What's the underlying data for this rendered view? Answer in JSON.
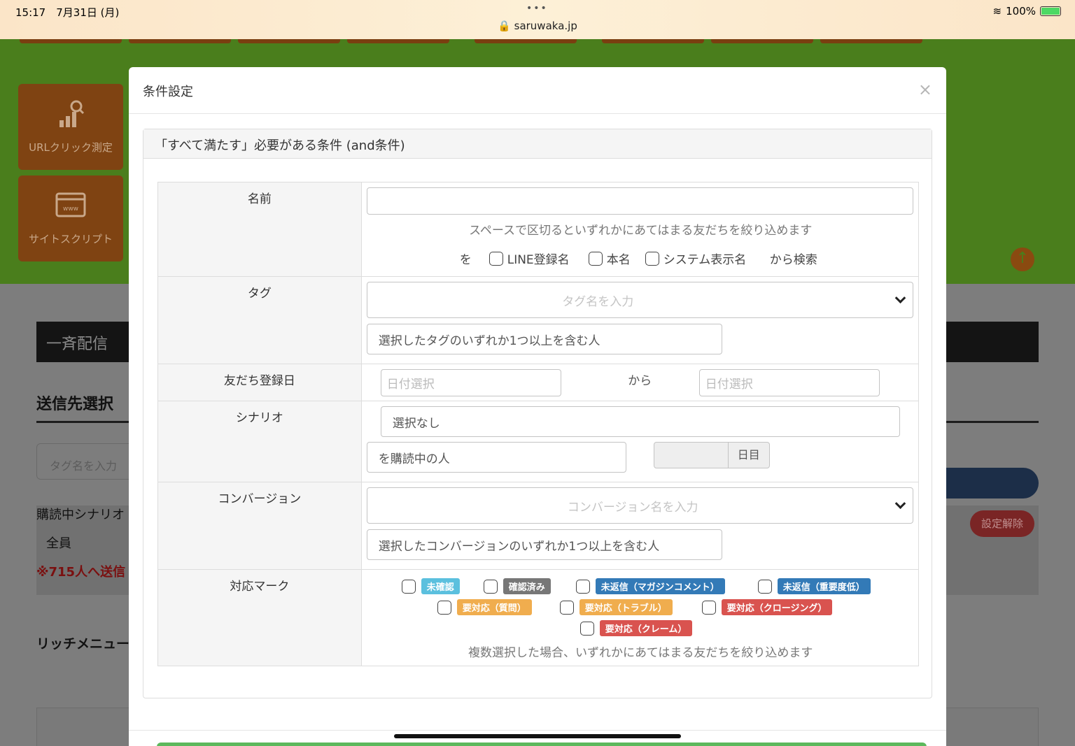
{
  "status_bar": {
    "time": "15:17　7月31日 (月)",
    "url": "saruwaka.jp",
    "battery": "100%"
  },
  "background": {
    "tiles": [
      {
        "label": "URLクリック測定",
        "icon": "chart-search-icon"
      },
      {
        "label": "サイトスクリプト",
        "icon": "browser-www-icon"
      }
    ],
    "section_title": "一斉配信",
    "heading": "送信先選択",
    "tag_input_placeholder": "タグ名を入力",
    "scenario_label": "購読中シナリオ",
    "scenario_value": "全員",
    "send_count": "※715人へ送信",
    "release_button": "設定解除",
    "rich_menu_label": "リッチメニュー"
  },
  "modal": {
    "title": "条件設定",
    "close_label": "×",
    "panel_heading": "「すべて満たす」必要がある条件 (and条件)",
    "rows": {
      "name": {
        "label": "名前",
        "help": "スペースで区切るといずれかにあてはまる友だちを絞り込めます",
        "prefix": "を",
        "options": [
          "LINE登録名",
          "本名",
          "システム表示名"
        ],
        "suffix": "から検索"
      },
      "tag": {
        "label": "タグ",
        "placeholder": "タグ名を入力",
        "mode": "選択したタグのいずれか1つ以上を含む人"
      },
      "date": {
        "label": "友だち登録日",
        "from_placeholder": "日付選択",
        "separator": "から",
        "to_placeholder": "日付選択"
      },
      "scenario": {
        "label": "シナリオ",
        "value": "選択なし",
        "mode": "を購読中の人",
        "day_addon": "日目"
      },
      "conversion": {
        "label": "コンバージョン",
        "placeholder": "コンバージョン名を入力",
        "mode": "選択したコンバージョンのいずれか1つ以上を含む人"
      },
      "marks": {
        "label": "対応マーク",
        "items": [
          {
            "label": "未確認",
            "color": "#5bc0de"
          },
          {
            "label": "確認済み",
            "color": "#777777"
          },
          {
            "label": "未返信（マガジンコメント）",
            "color": "#337ab7"
          },
          {
            "label": "未返信（重要度低）",
            "color": "#337ab7"
          },
          {
            "label": "要対応（質問）",
            "color": "#f0ad4e"
          },
          {
            "label": "要対応（トラブル）",
            "color": "#f0ad4e"
          },
          {
            "label": "要対応（クロージング）",
            "color": "#d9534f"
          },
          {
            "label": "要対応（クレーム）",
            "color": "#d9534f"
          }
        ],
        "help": "複数選択した場合、いずれかにあてはまる友だちを絞り込めます"
      }
    }
  }
}
